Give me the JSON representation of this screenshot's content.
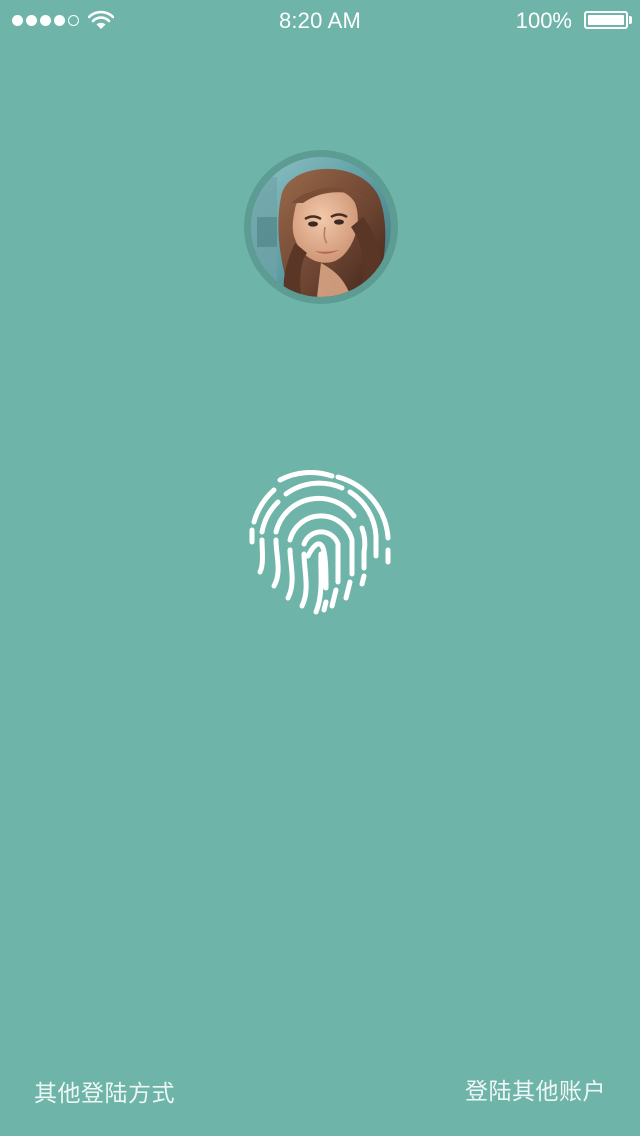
{
  "status_bar": {
    "time": "8:20 AM",
    "battery_percent": "100%",
    "signal_bars_filled": 4,
    "signal_bars_total": 5,
    "battery_level": 1.0
  },
  "profile": {
    "avatar_icon": "user-photo"
  },
  "auth": {
    "fingerprint_icon": "fingerprint-icon"
  },
  "footer": {
    "other_login_methods": "其他登陆方式",
    "login_other_account": "登陆其他账户"
  },
  "colors": {
    "background": "#6fb4a9",
    "avatar_ring": "#5c9c92",
    "foreground": "#ffffff"
  }
}
